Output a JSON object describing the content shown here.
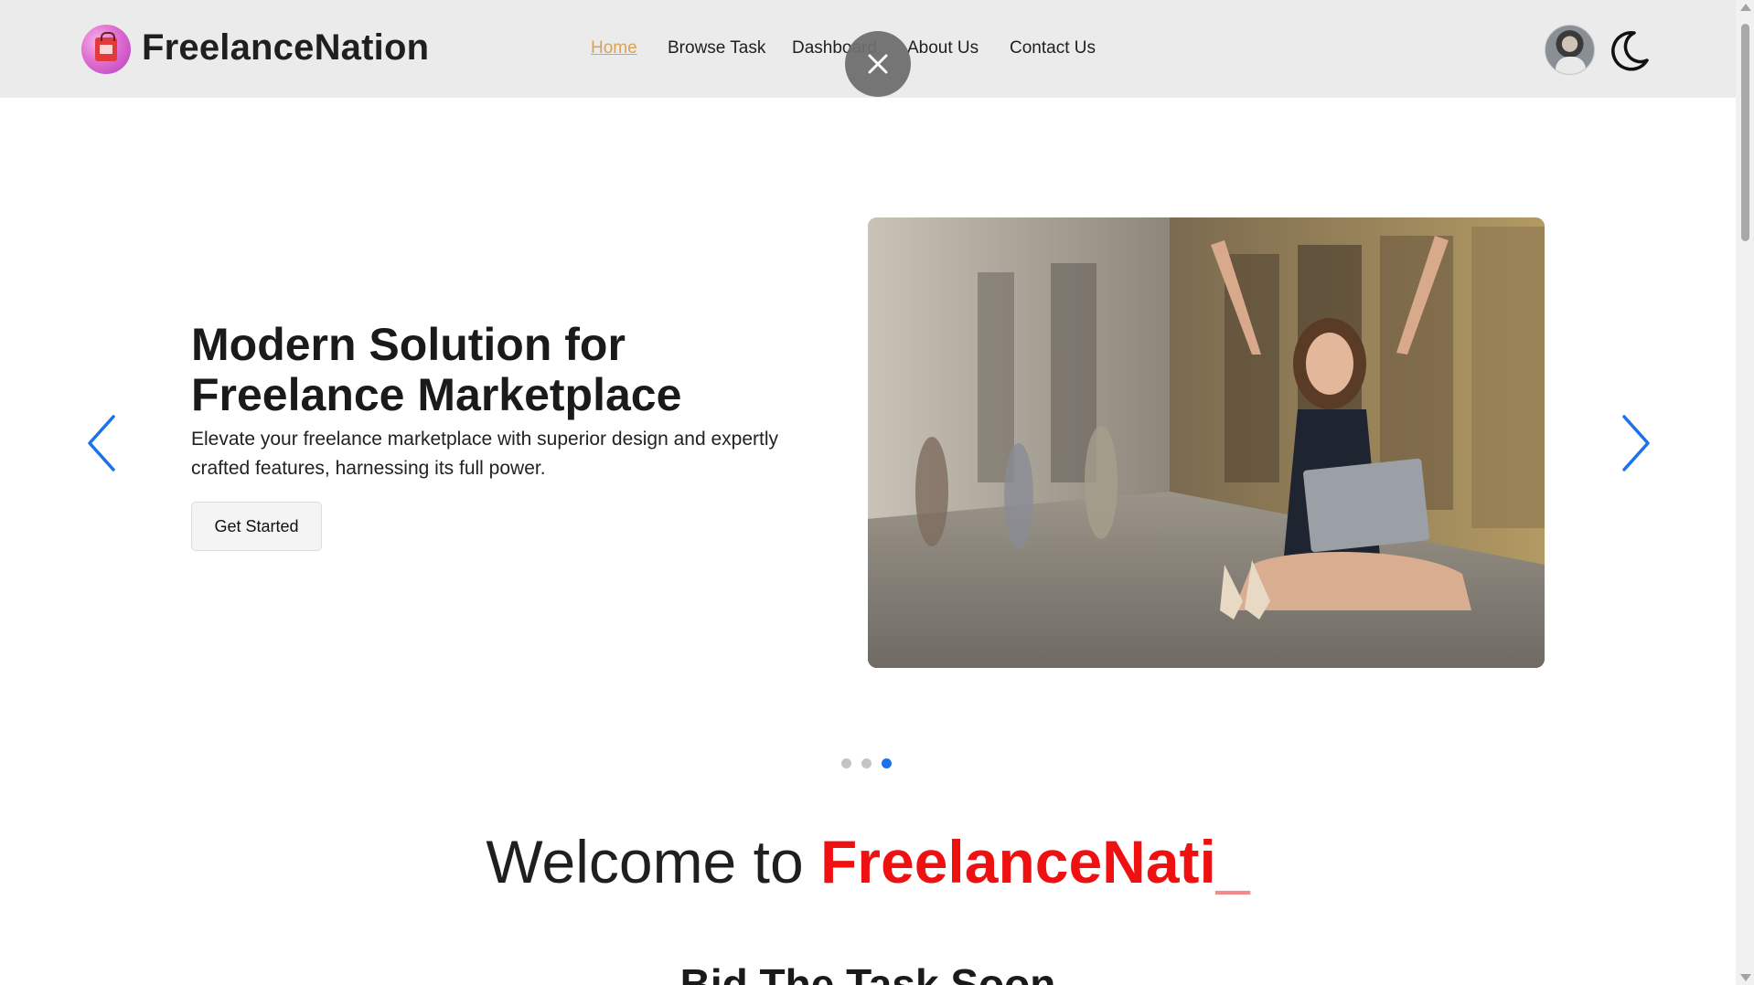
{
  "brand": {
    "name": "FreelanceNation",
    "logo_icon": "shopping-bag-logo-icon"
  },
  "nav": {
    "items": [
      {
        "label": "Home",
        "active": true
      },
      {
        "label": "Browse Task",
        "active": false
      },
      {
        "label": "Dashboard",
        "active": false
      },
      {
        "label": "About Us",
        "active": false
      },
      {
        "label": "Contact Us",
        "active": false
      }
    ],
    "active_color": "#d7a35a"
  },
  "header_actions": {
    "avatar_icon": "user-avatar",
    "theme_toggle_icon": "moon-icon",
    "close_icon": "close-icon"
  },
  "hero": {
    "title": "Modern Solution for Freelance Marketplace",
    "description": "Elevate your freelance marketplace with superior design and expertly crafted features, harnessing its full power.",
    "cta_label": "Get Started",
    "prev_icon": "chevron-left-icon",
    "next_icon": "chevron-right-icon",
    "arrow_color": "#1a73e8",
    "slides_count": 3,
    "active_slide": 3
  },
  "welcome": {
    "prefix": "Welcome to ",
    "typed_text": "FreelanceNati",
    "cursor": "_",
    "accent_color": "#ef1111"
  },
  "section": {
    "title": "Bid The Task Soon"
  }
}
